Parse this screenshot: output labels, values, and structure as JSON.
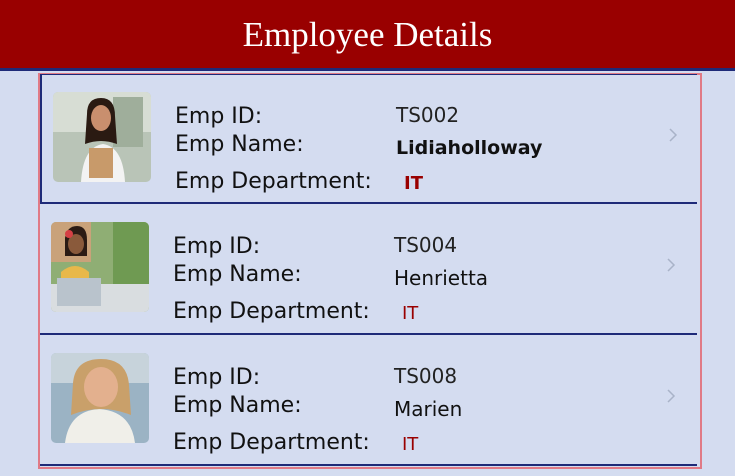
{
  "header": {
    "title": "Employee Details",
    "background": "#990000"
  },
  "labels": {
    "emp_id": "Emp ID:",
    "emp_name": "Emp Name:",
    "emp_department": "Emp Department:"
  },
  "employees": [
    {
      "id": "TS002",
      "name": "Lidiaholloway",
      "department": "IT",
      "photo_icon": "employee-photo"
    },
    {
      "id": "TS004",
      "name": "Henrietta",
      "department": "IT",
      "photo_icon": "employee-photo"
    },
    {
      "id": "TS008",
      "name": "Marien",
      "department": "IT",
      "photo_icon": "employee-photo"
    }
  ],
  "colors": {
    "department_text": "#990000",
    "background": "#d4dcf0",
    "row_divider": "#1e2a78",
    "selection_border": "#e07a86"
  }
}
